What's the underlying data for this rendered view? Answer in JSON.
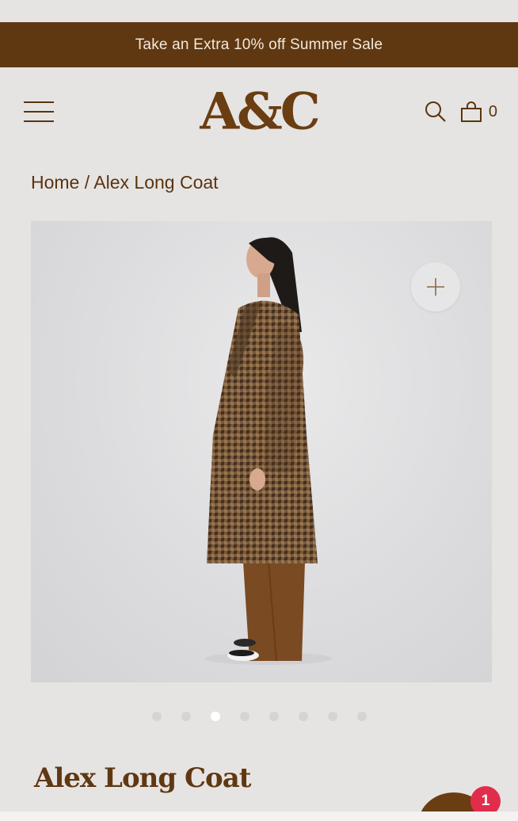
{
  "promo": {
    "text": "Take an Extra 10% off Summer Sale"
  },
  "header": {
    "logo": "A&C",
    "menu_icon": "hamburger-menu-icon",
    "search_icon": "search-icon",
    "cart_icon": "shopping-bag-icon",
    "cart_count": "0"
  },
  "breadcrumb": {
    "home": "Home",
    "separator": "/",
    "current": "Alex Long Coat"
  },
  "gallery": {
    "zoom_icon": "plus-icon",
    "slide_count": 8,
    "active_slide": 3
  },
  "product": {
    "title": "Alex Long Coat"
  },
  "chat": {
    "badge_count": "1"
  },
  "colors": {
    "brand_brown": "#5f3812",
    "background": "#e6e4e2",
    "badge_red": "#e12d4c"
  }
}
